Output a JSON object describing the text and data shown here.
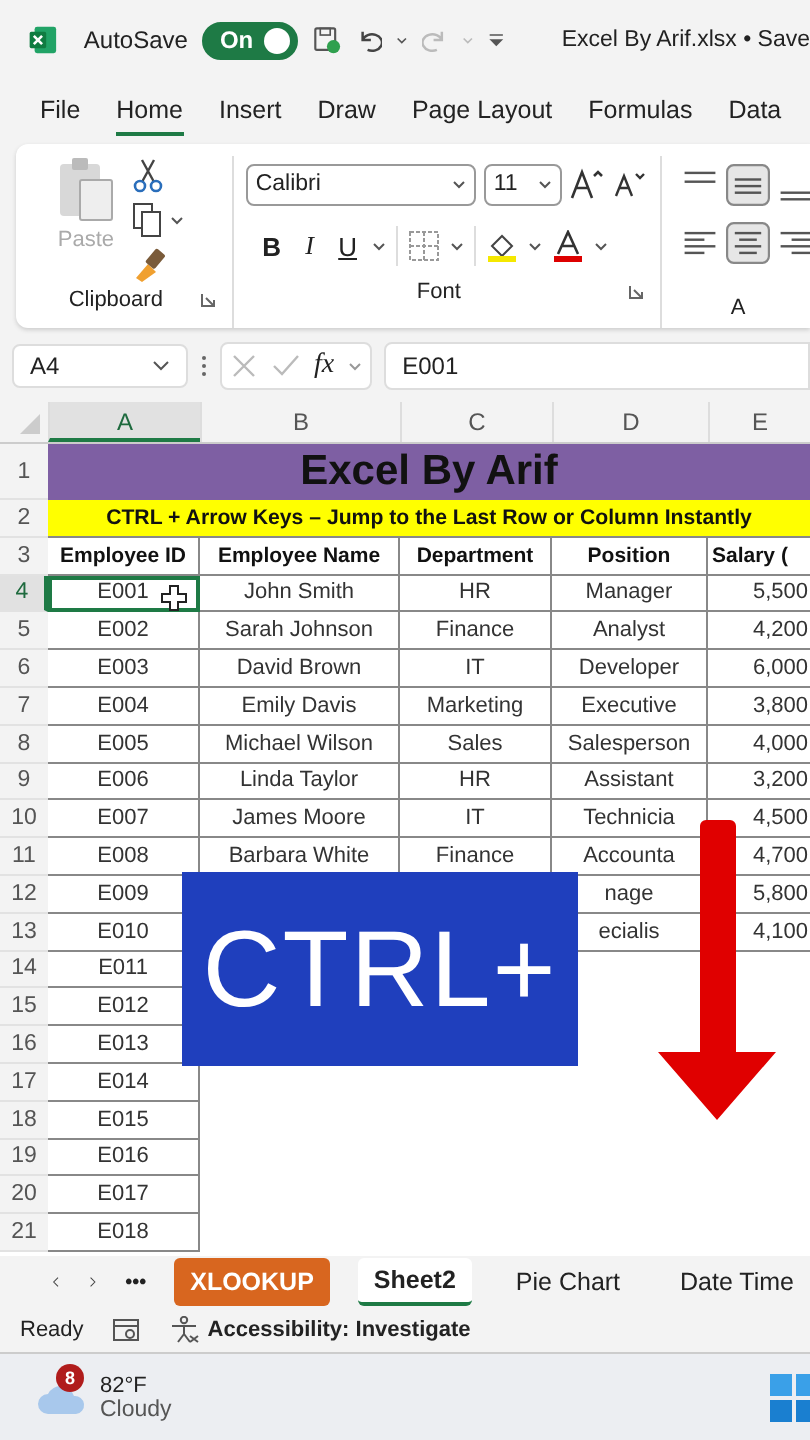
{
  "title_bar": {
    "autosave_label": "AutoSave",
    "autosave": {
      "label": "On",
      "on": true
    },
    "redo_disabled": true,
    "document_title": "Excel By Arif.xlsx • Save"
  },
  "menu_tabs": [
    {
      "label": "File",
      "selected": false
    },
    {
      "label": "Home",
      "selected": true
    },
    {
      "label": "Insert",
      "selected": false
    },
    {
      "label": "Draw",
      "selected": false
    },
    {
      "label": "Page Layout",
      "selected": false
    },
    {
      "label": "Formulas",
      "selected": false
    },
    {
      "label": "Data",
      "selected": false
    }
  ],
  "ribbon": {
    "clipboard": {
      "paste_label": "Paste",
      "paste_disabled": true,
      "group_label": "Clipboard"
    },
    "font": {
      "font_name": "Calibri",
      "font_size": "11",
      "bold_label": "B",
      "italic_label": "I",
      "underline_label": "U",
      "group_label": "Font"
    },
    "alignment": {
      "group_label": "A",
      "buttons": [
        {
          "kind": "top",
          "selected": false
        },
        {
          "kind": "middle",
          "selected": true
        },
        {
          "kind": "bottom",
          "selected": false
        },
        {
          "kind": "left",
          "selected": false
        },
        {
          "kind": "center",
          "selected": true
        },
        {
          "kind": "right",
          "selected": false
        }
      ]
    }
  },
  "formula_bar": {
    "name_box": "A4",
    "function_label": "fx",
    "value": "E001"
  },
  "sheet": {
    "columns": [
      {
        "label": "A",
        "selected": true
      },
      {
        "label": "B",
        "selected": false
      },
      {
        "label": "C",
        "selected": false
      },
      {
        "label": "D",
        "selected": false
      },
      {
        "label": "E",
        "selected": false
      }
    ],
    "rows": [
      {
        "number": "1",
        "kind": "title",
        "selected": false,
        "text": "Excel By Arif"
      },
      {
        "number": "2",
        "kind": "banner",
        "selected": false,
        "text": "CTRL + Arrow Keys – Jump to the Last Row or Column Instantly"
      },
      {
        "number": "3",
        "kind": "header",
        "selected": false,
        "cells": {
          "id": "Employee ID",
          "name": "Employee Name",
          "department": "Department",
          "position": "Position",
          "salary": "Salary ("
        }
      },
      {
        "number": "4",
        "kind": "data",
        "selected": true,
        "cells": {
          "id": "E001",
          "name": "John Smith",
          "department": "HR",
          "position": "Manager",
          "salary": "5,500"
        }
      },
      {
        "number": "5",
        "kind": "data",
        "selected": false,
        "cells": {
          "id": "E002",
          "name": "Sarah Johnson",
          "department": "Finance",
          "position": "Analyst",
          "salary": "4,200"
        }
      },
      {
        "number": "6",
        "kind": "data",
        "selected": false,
        "cells": {
          "id": "E003",
          "name": "David Brown",
          "department": "IT",
          "position": "Developer",
          "salary": "6,000"
        }
      },
      {
        "number": "7",
        "kind": "data",
        "selected": false,
        "cells": {
          "id": "E004",
          "name": "Emily Davis",
          "department": "Marketing",
          "position": "Executive",
          "salary": "3,800"
        }
      },
      {
        "number": "8",
        "kind": "data",
        "selected": false,
        "cells": {
          "id": "E005",
          "name": "Michael Wilson",
          "department": "Sales",
          "position": "Salesperson",
          "salary": "4,000"
        }
      },
      {
        "number": "9",
        "kind": "data",
        "selected": false,
        "cells": {
          "id": "E006",
          "name": "Linda Taylor",
          "department": "HR",
          "position": "Assistant",
          "salary": "3,200"
        }
      },
      {
        "number": "10",
        "kind": "data",
        "selected": false,
        "cells": {
          "id": "E007",
          "name": "James Moore",
          "department": "IT",
          "position": "Technicia",
          "salary": "4,500"
        }
      },
      {
        "number": "11",
        "kind": "data",
        "selected": false,
        "cells": {
          "id": "E008",
          "name": "Barbara White",
          "department": "Finance",
          "position": "Accounta",
          "salary": "4,700"
        }
      },
      {
        "number": "12",
        "kind": "data",
        "selected": false,
        "cells": {
          "id": "E009",
          "position": "nage",
          "salary": "5,800"
        }
      },
      {
        "number": "13",
        "kind": "data",
        "selected": false,
        "cells": {
          "id": "E010",
          "position": "ecialis",
          "salary": "4,100"
        }
      },
      {
        "number": "14",
        "kind": "data",
        "selected": false,
        "cells": {
          "id": "E011"
        }
      },
      {
        "number": "15",
        "kind": "data",
        "selected": false,
        "cells": {
          "id": "E012"
        }
      },
      {
        "number": "16",
        "kind": "data",
        "selected": false,
        "cells": {
          "id": "E013"
        }
      },
      {
        "number": "17",
        "kind": "data",
        "selected": false,
        "cells": {
          "id": "E014"
        }
      },
      {
        "number": "18",
        "kind": "data",
        "selected": false,
        "cells": {
          "id": "E015"
        }
      },
      {
        "number": "19",
        "kind": "data",
        "selected": false,
        "cells": {
          "id": "E016"
        }
      },
      {
        "number": "20",
        "kind": "data",
        "selected": false,
        "cells": {
          "id": "E017"
        }
      },
      {
        "number": "21",
        "kind": "data",
        "selected": false,
        "cells": {
          "id": "E018"
        }
      }
    ],
    "overlay": {
      "caption": "CTRL+"
    }
  },
  "sheet_tabs": {
    "more_label": "•••",
    "tabs": [
      {
        "label": "XLOOKUP",
        "selected": false,
        "color": "#d8661f"
      },
      {
        "label": "Sheet2",
        "selected": true
      },
      {
        "label": "Pie Chart",
        "selected": false
      },
      {
        "label": "Date Time",
        "selected": false
      }
    ]
  },
  "status_bar": {
    "mode": "Ready",
    "accessibility": "Accessibility: Investigate"
  },
  "taskbar": {
    "badge": "8",
    "temperature": "82°F",
    "condition": "Cloudy"
  }
}
